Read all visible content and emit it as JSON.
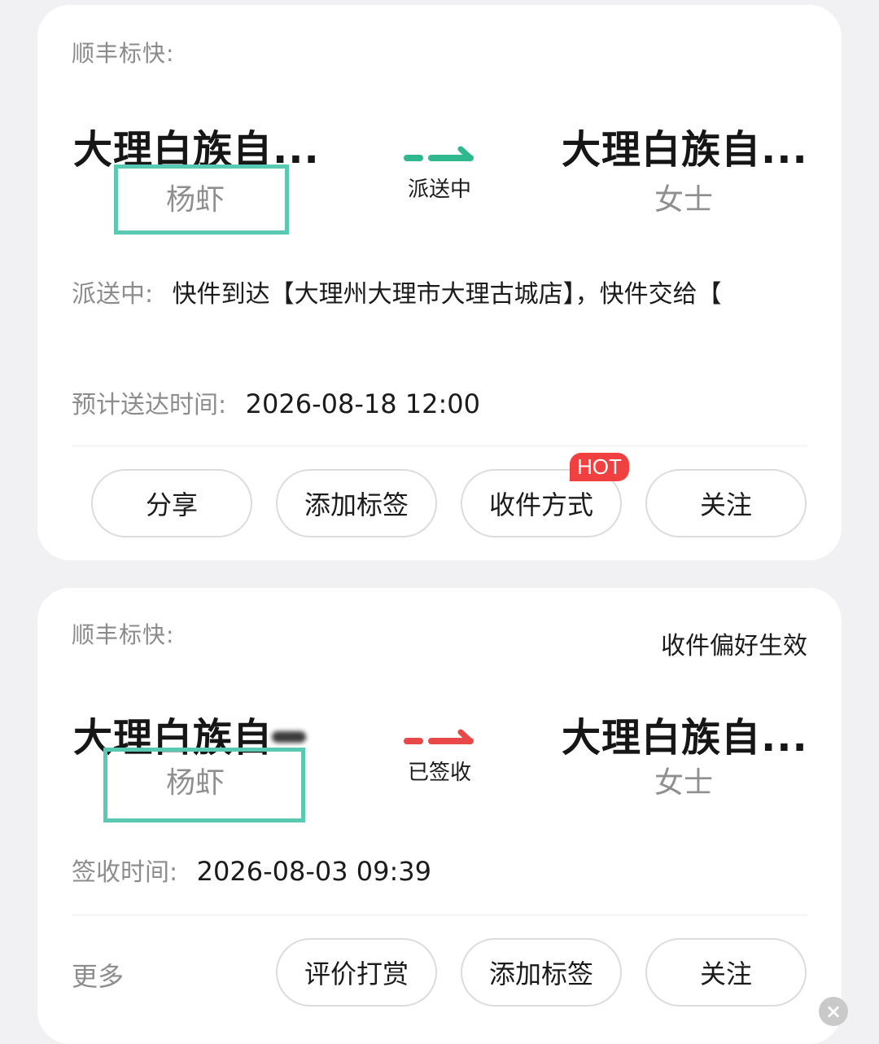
{
  "parcels": [
    {
      "carrier": "顺丰标快:",
      "origin_city": "大理白族自...",
      "sender": "杨虾",
      "status": "派送中",
      "dest_city": "大理白族自...",
      "recipient": "女士",
      "track_label": "派送中:",
      "track_text": "快件到达【大理州大理市大理古城店】，快件交给【",
      "eta_label": "预计送达时间:",
      "eta_value": "2026-08-18 12:00",
      "buttons": [
        "分享",
        "添加标签",
        "收件方式",
        "关注"
      ],
      "hot_badge": "HOT",
      "status_color": "#2fb88e"
    },
    {
      "carrier": "顺丰标快:",
      "preference": "收件偏好生效",
      "origin_city": "大理白族自",
      "sender": "杨虾",
      "status": "已签收",
      "dest_city": "大理白族自...",
      "recipient": "女士",
      "signed_label": "签收时间:",
      "signed_value": "2026-08-03 09:39",
      "more_label": "更多",
      "buttons": [
        "评价打赏",
        "添加标签",
        "关注"
      ],
      "status_color": "#e84848"
    }
  ],
  "highlight_color": "#5ac9b3",
  "close_icon": "close-icon"
}
